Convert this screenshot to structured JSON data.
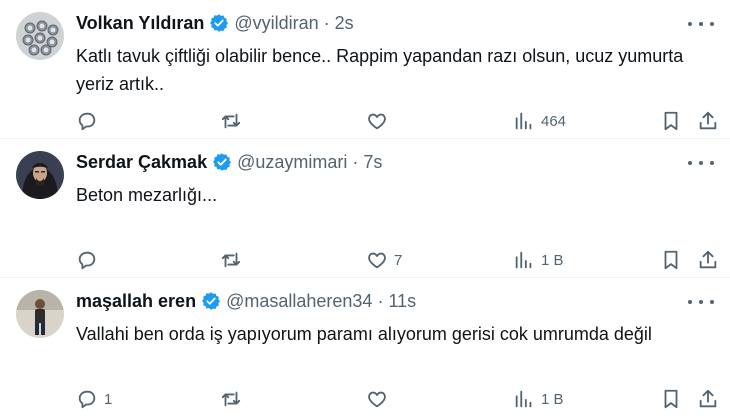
{
  "tweets": [
    {
      "name": "Volkan Yıldıran",
      "handle": "@vyildiran",
      "time": "2s",
      "text": "Katlı tavuk çiftliği olabilir bence.. Rappim yapandan razı olsun, ucuz yumurta yeriz artık..",
      "replies": "",
      "retweets": "",
      "likes": "",
      "views": "464"
    },
    {
      "name": "Serdar Çakmak",
      "handle": "@uzaymimari",
      "time": "7s",
      "text": "Beton mezarlığı...",
      "replies": "",
      "retweets": "",
      "likes": "7",
      "views": "1 B"
    },
    {
      "name": "maşallah eren",
      "handle": "@masallaheren34",
      "time": "11s",
      "text": "Vallahi ben orda iş yapıyorum paramı alıyorum gerisi cok umrumda değil",
      "replies": "1",
      "retweets": "",
      "likes": "",
      "views": "1 B"
    }
  ],
  "colors": {
    "verified": "#1d9bf0",
    "muted": "#536471",
    "text": "#0f1419"
  },
  "icons": [
    "reply-icon",
    "retweet-icon",
    "like-icon",
    "views-icon",
    "bookmark-icon",
    "share-icon",
    "more-icon",
    "verified-badge-icon"
  ]
}
